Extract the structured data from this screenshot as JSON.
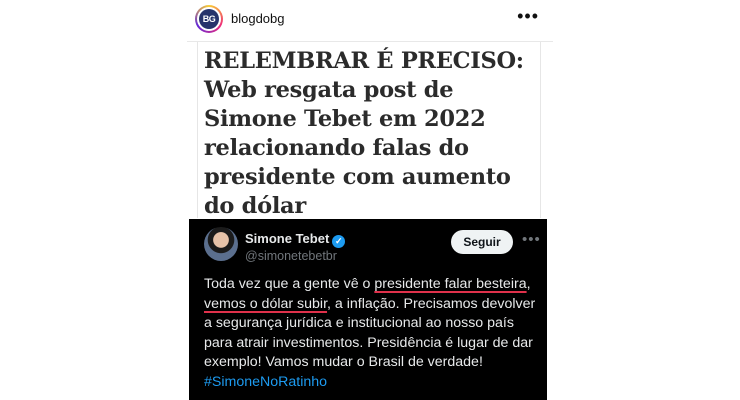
{
  "header": {
    "avatar_text": "BG",
    "username": "blogdobg",
    "more_icon": "more-horizontal-icon"
  },
  "headline": {
    "prefix": "RELEMBRAR É PRECISO",
    "text": ": Web resgata post de Simone Tebet em 2022 relacionando falas do presidente com aumento do dólar"
  },
  "tweet": {
    "name": "Simone Tebet",
    "handle": "@simonetebetbr",
    "follow_label": "Seguir",
    "text_parts": {
      "part1": "Toda vez que a gente vê o ",
      "underline1": "presidente falar besteira",
      "part2": ", ",
      "underline2": "vemos o dólar subir",
      "part3": ", a inflação. Precisamos devolver a segurança jurídica e institucional ao nosso país para atrair investimentos. Presidência é lugar de dar exemplo! Vamos mudar o Brasil de verdade! ",
      "hashtag": "#SimoneNoRatinho"
    }
  },
  "colors": {
    "tweet_bg": "#000000",
    "hashtag": "#1d9bf0",
    "underline": "#e0314b",
    "verified": "#1d9bf0"
  }
}
